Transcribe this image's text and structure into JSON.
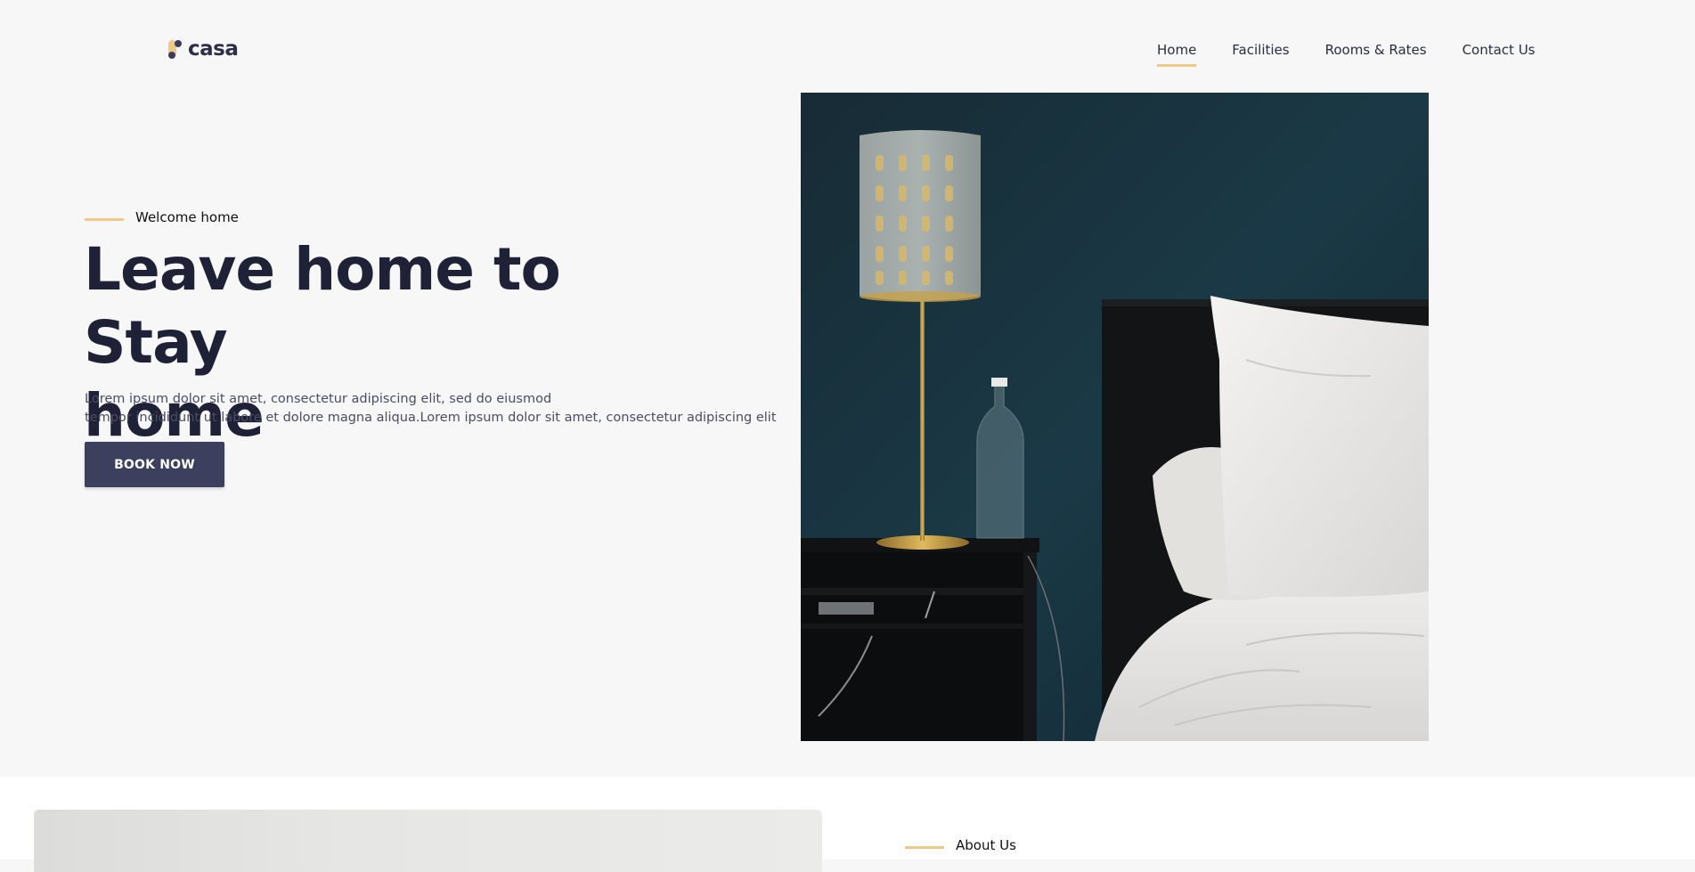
{
  "brand": {
    "name": "casa",
    "accent_color": "#f0c989",
    "primary_color": "#3d3f5f"
  },
  "nav": {
    "items": [
      {
        "label": "Home",
        "active": true
      },
      {
        "label": "Facilities",
        "active": false
      },
      {
        "label": "Rooms & Rates",
        "active": false
      },
      {
        "label": "Contact Us",
        "active": false
      }
    ]
  },
  "hero": {
    "eyebrow": "Welcome home",
    "title_line1": "Leave home to Stay",
    "title_line2": "home",
    "description_line1": "Lorem ipsum dolor sit amet, consectetur adipiscing elit, sed do eiusmod",
    "description_line2": "tempor incididunt ut labore et dolore magna aliqua.Lorem ipsum dolor sit amet, consectetur adipiscing elit",
    "cta_label": "BOOK NOW"
  },
  "about": {
    "eyebrow": "About Us"
  }
}
